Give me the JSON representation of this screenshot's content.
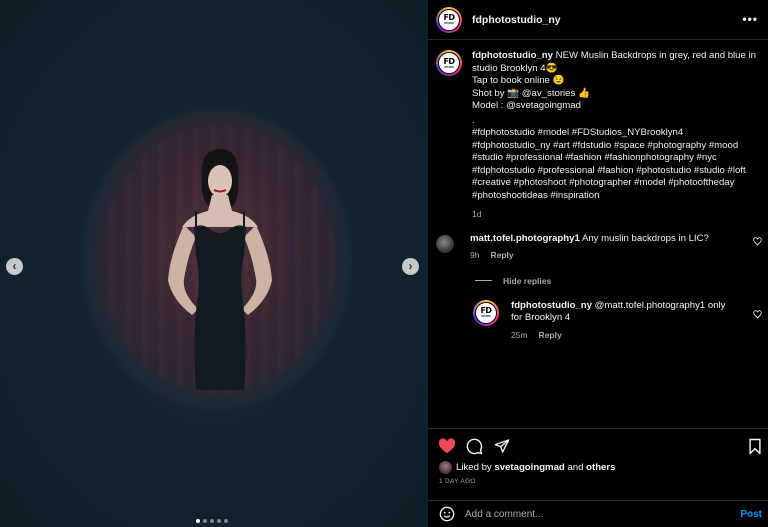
{
  "media": {
    "carousel_slides": 5,
    "active_slide": 1,
    "prev_icon": "chevron-left-icon",
    "next_icon": "chevron-right-icon"
  },
  "header": {
    "username": "fdphotostudio_ny",
    "avatar_text": "FD",
    "avatar_subtext": "STUDIO",
    "more_icon": "more-dots-icon",
    "more_label": "•••"
  },
  "caption": {
    "username": "fdphotostudio_ny",
    "lines": [
      "NEW Muslin Backdrops in grey, red and blue in studio Brooklyn 4😎",
      "Tap to book online 😉",
      "Shot by 📸 @av_stories 👍",
      "Model : @svetagoingmad",
      ".",
      "#fdphotostudio #model #FDStudios_NYBrooklyn4 #fdphotostudio_ny #art #fdstudio #space #photography #mood #studio #professional #fashion #fashionphotography #nyc #fdphotostudio #professional #fashion #photostudio #studio #loft #creative #photoshoot #photographer #model #photooftheday #photoshootideas #inspiration"
    ],
    "time": "1d"
  },
  "comments": [
    {
      "username": "matt.tofel.photography1",
      "text": "Any muslin backdrops in LIC?",
      "time": "9h",
      "reply_label": "Reply"
    }
  ],
  "hide_replies_label": "Hide replies",
  "reply": {
    "username": "fdphotostudio_ny",
    "text": "@matt.tofel.photography1 only for Brooklyn 4",
    "time": "25m",
    "reply_label": "Reply"
  },
  "actions": {
    "icons": [
      "heart-filled-icon",
      "comment-icon",
      "share-icon",
      "bookmark-icon"
    ],
    "liked_prefix": "Liked by",
    "liked_user": "svetagoingmad",
    "liked_and": "and",
    "liked_others": "others",
    "posted_ago": "1 DAY AGO"
  },
  "add_comment": {
    "placeholder": "Add a comment...",
    "post_label": "Post",
    "emoji_icon": "emoji-smile-icon"
  },
  "colors": {
    "heart": "#ed4956",
    "post_button": "#0095f6",
    "background": "#000000",
    "muted_text": "#a8a8a8"
  }
}
